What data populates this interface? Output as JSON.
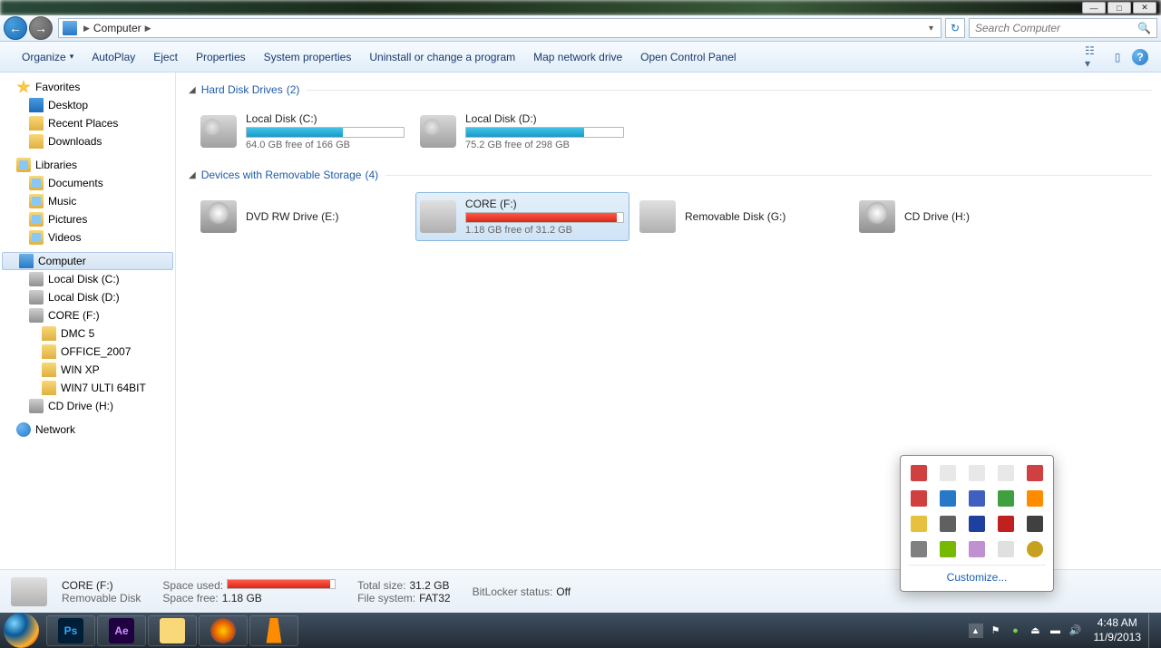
{
  "titlebar": {
    "min": "—",
    "max": "□",
    "close": "✕"
  },
  "nav": {
    "location": "Computer"
  },
  "search": {
    "placeholder": "Search Computer"
  },
  "toolbar": {
    "organize": "Organize",
    "autoplay": "AutoPlay",
    "eject": "Eject",
    "properties": "Properties",
    "system_properties": "System properties",
    "uninstall": "Uninstall or change a program",
    "map_network": "Map network drive",
    "open_cp": "Open Control Panel"
  },
  "sidebar": {
    "favorites": {
      "label": "Favorites",
      "items": [
        "Desktop",
        "Recent Places",
        "Downloads"
      ]
    },
    "libraries": {
      "label": "Libraries",
      "items": [
        "Documents",
        "Music",
        "Pictures",
        "Videos"
      ]
    },
    "computer": {
      "label": "Computer",
      "drives": [
        "Local Disk (C:)",
        "Local Disk (D:)",
        "CORE (F:)",
        "CD Drive (H:)"
      ],
      "core_folders": [
        "DMC 5",
        "OFFICE_2007",
        "WIN XP",
        "WIN7 ULTI 64BIT"
      ]
    },
    "network": {
      "label": "Network"
    }
  },
  "content": {
    "group_hdd": {
      "title": "Hard Disk Drives",
      "count": "(2)"
    },
    "group_removable": {
      "title": "Devices with Removable Storage",
      "count": "(4)"
    },
    "drives": {
      "c": {
        "name": "Local Disk (C:)",
        "free": "64.0 GB free of 166 GB",
        "fill_pct": 61
      },
      "d": {
        "name": "Local Disk (D:)",
        "free": "75.2 GB free of 298 GB",
        "fill_pct": 75
      },
      "dvd": {
        "name": "DVD RW Drive (E:)"
      },
      "core": {
        "name": "CORE (F:)",
        "free": "1.18 GB free of 31.2 GB",
        "fill_pct": 96
      },
      "g": {
        "name": "Removable Disk (G:)"
      },
      "h": {
        "name": "CD Drive (H:)"
      }
    }
  },
  "details": {
    "name": "CORE (F:)",
    "type": "Removable Disk",
    "space_used_label": "Space used:",
    "space_free_label": "Space free:",
    "space_free": "1.18 GB",
    "total_label": "Total size:",
    "total": "31.2 GB",
    "fs_label": "File system:",
    "fs": "FAT32",
    "bitlocker_label": "BitLocker status:",
    "bitlocker": "Off"
  },
  "tray_popup": {
    "customize": "Customize..."
  },
  "taskbar": {
    "apps": [
      {
        "label": "Ps",
        "bg": "#001e36",
        "fg": "#31a8ff"
      },
      {
        "label": "Ae",
        "bg": "#1f0040",
        "fg": "#d291ff"
      },
      {
        "label": "",
        "bg": "#f8d878",
        "fg": "#fff"
      },
      {
        "label": "",
        "bg": "#e66000",
        "fg": "#fff"
      },
      {
        "label": "▲",
        "bg": "#ff8c00",
        "fg": "#fff"
      }
    ],
    "clock_time": "4:48 AM",
    "clock_date": "11/9/2013"
  }
}
